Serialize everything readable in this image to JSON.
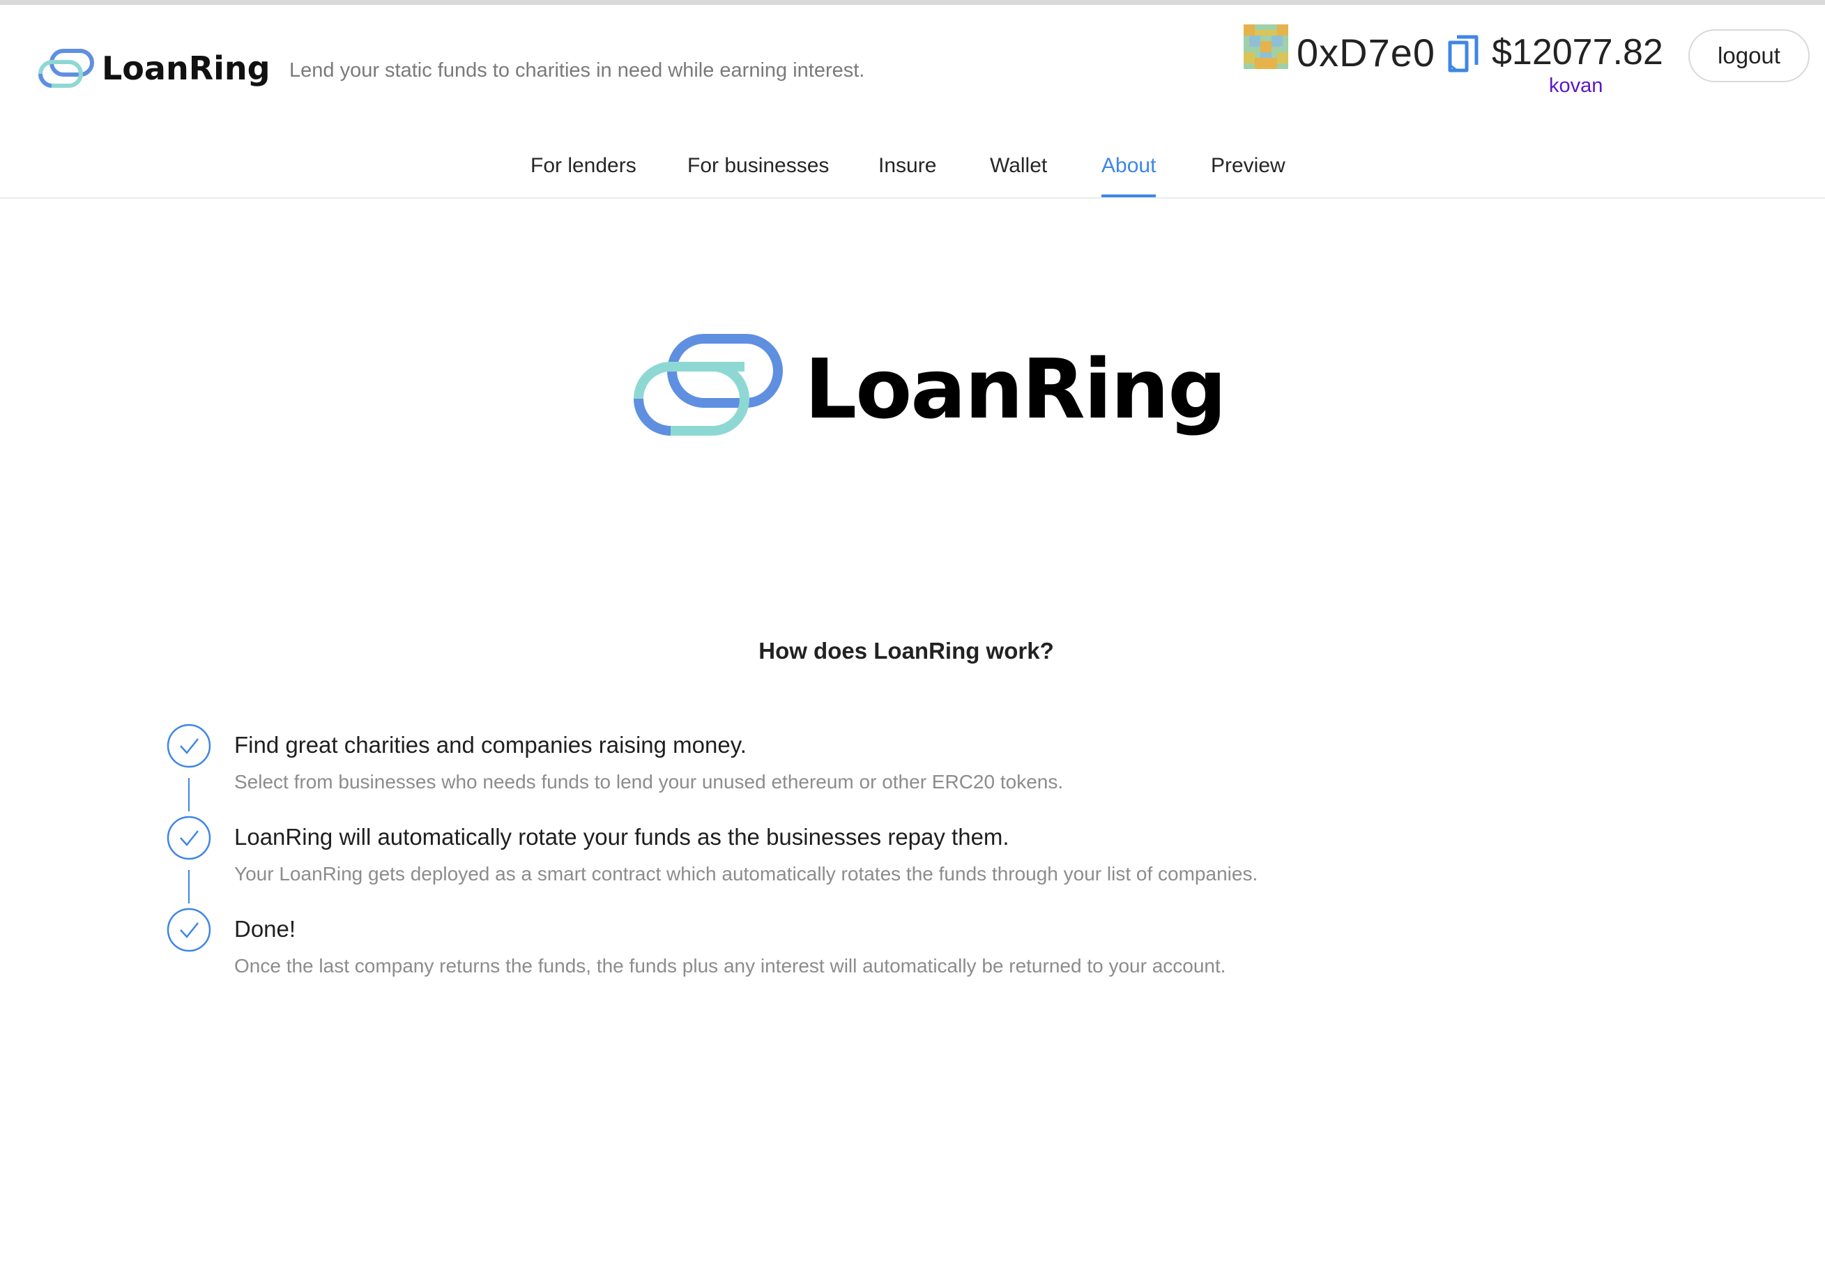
{
  "header": {
    "brand_name": "LoanRing",
    "tagline": "Lend your static funds to charities in need while earning interest.",
    "account": {
      "address": "0xD7e0",
      "balance": "$12077.82",
      "network": "kovan",
      "logout_label": "logout",
      "identicon": "identicon-avatar",
      "copy_icon": "copy-icon"
    }
  },
  "nav": {
    "items": [
      {
        "label": "For lenders"
      },
      {
        "label": "For businesses"
      },
      {
        "label": "Insure"
      },
      {
        "label": "Wallet"
      },
      {
        "label": "About"
      },
      {
        "label": "Preview"
      }
    ],
    "active": "About"
  },
  "hero": {
    "brand_name": "LoanRing"
  },
  "about": {
    "title": "How does LoanRing work?",
    "steps": [
      {
        "title": "Find great charities and companies raising money.",
        "description": "Select from businesses who needs funds to lend your unused ethereum or other ERC20 tokens."
      },
      {
        "title": "LoanRing will automatically rotate your funds as the businesses repay them.",
        "description": "Your LoanRing gets deployed as a smart contract which automatically rotates the funds through your list of companies."
      },
      {
        "title": "Done!",
        "description": "Once the last company returns the funds, the funds plus any interest will automatically be returned to your account."
      }
    ]
  },
  "colors": {
    "accent": "#3d86e6",
    "network": "#5c16c5",
    "logo_teal": "#8ed8d4",
    "logo_blue": "#5f8fe0",
    "muted_text": "#8c8c8c"
  }
}
